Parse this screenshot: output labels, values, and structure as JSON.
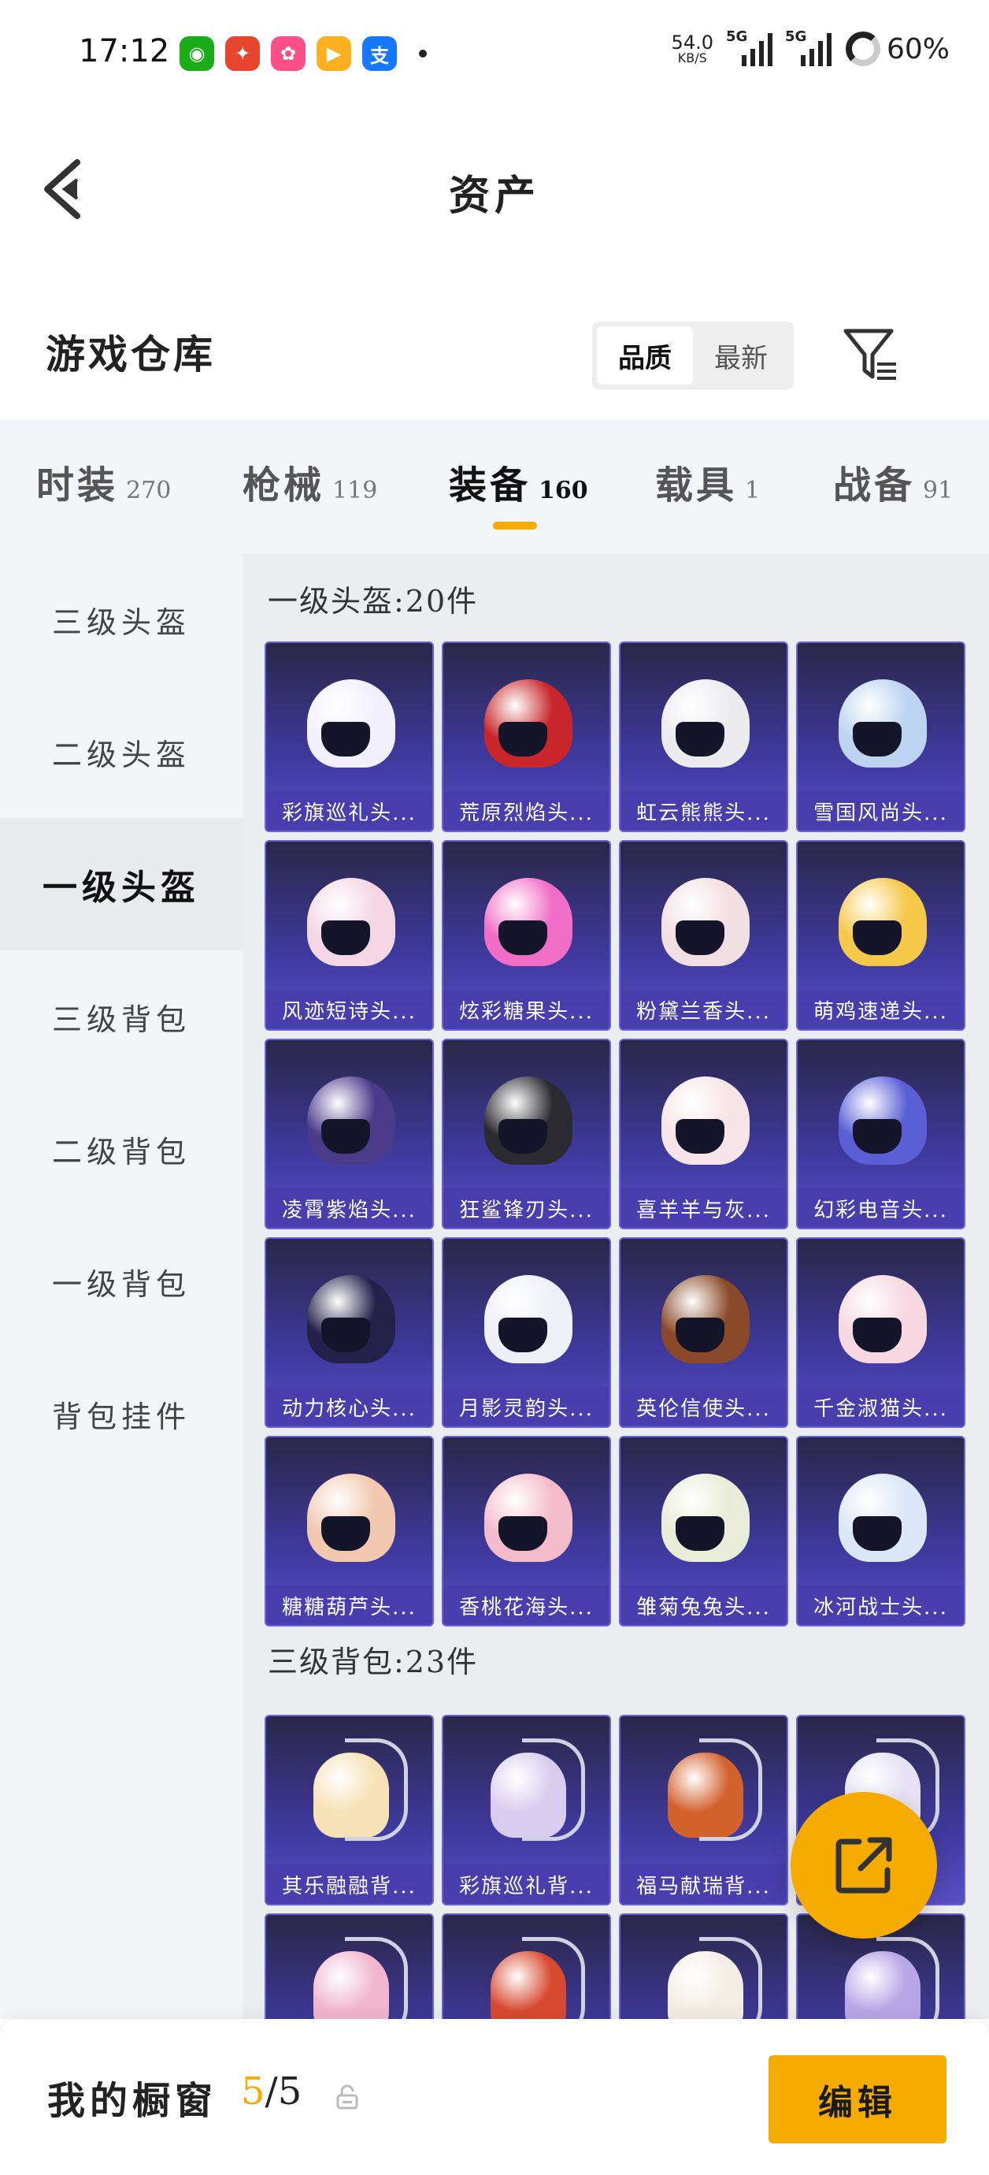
{
  "status_bar": {
    "time": "17:12",
    "apps": [
      {
        "icon": "wechat-icon",
        "glyph": "◉",
        "color": "#1aad19"
      },
      {
        "icon": "red-envelope-app-icon",
        "glyph": "✦",
        "color": "#e8452e"
      },
      {
        "icon": "pink-app-icon",
        "glyph": "✿",
        "color": "#ff4f88"
      },
      {
        "icon": "video-app-icon",
        "glyph": "▶",
        "color": "#ffb020"
      },
      {
        "icon": "alipay-icon",
        "glyph": "支",
        "color": "#1677ff"
      }
    ],
    "net_speed": "54.0",
    "net_unit": "KB/S",
    "sim1": "5G",
    "sim2": "5G",
    "battery": "60%"
  },
  "header": {
    "title": "资产",
    "back_icon": "back-arrow-icon"
  },
  "warehouse": {
    "title": "游戏仓库",
    "sort": [
      "品质",
      "最新"
    ],
    "active_sort": 0,
    "filter_icon": "filter-icon"
  },
  "tabs": [
    {
      "label": "时装",
      "count": "270"
    },
    {
      "label": "枪械",
      "count": "119"
    },
    {
      "label": "装备",
      "count": "160"
    },
    {
      "label": "载具",
      "count": "1"
    },
    {
      "label": "战备",
      "count": "91"
    }
  ],
  "active_tab": 2,
  "sidebar": [
    {
      "label": "三级头盔"
    },
    {
      "label": "二级头盔"
    },
    {
      "label": "一级头盔"
    },
    {
      "label": "三级背包"
    },
    {
      "label": "二级背包"
    },
    {
      "label": "一级背包"
    },
    {
      "label": "背包挂件"
    }
  ],
  "active_side": 2,
  "sections": [
    {
      "title": "一级头盔:20件",
      "items": [
        {
          "name": "彩旗巡礼头...",
          "color": "#f2f0ff"
        },
        {
          "name": "荒原烈焰头...",
          "color": "#c8262a"
        },
        {
          "name": "虹云熊熊头...",
          "color": "#ecebf0"
        },
        {
          "name": "雪国风尚头...",
          "color": "#bcd4f2"
        },
        {
          "name": "风迹短诗头...",
          "color": "#f4d6e4"
        },
        {
          "name": "炫彩糖果头...",
          "color": "#f06ec6"
        },
        {
          "name": "粉黛兰香头...",
          "color": "#f2dfe4"
        },
        {
          "name": "萌鸡速递头...",
          "color": "#f5c84a"
        },
        {
          "name": "凌霄紫焰头...",
          "color": "#4a3a8a"
        },
        {
          "name": "狂鲨锋刃头...",
          "color": "#2a2a30"
        },
        {
          "name": "喜羊羊与灰...",
          "color": "#f7e4e8"
        },
        {
          "name": "幻彩电音头...",
          "color": "#5b5fd6"
        },
        {
          "name": "动力核心头...",
          "color": "#23204a"
        },
        {
          "name": "月影灵韵头...",
          "color": "#eef0f8"
        },
        {
          "name": "英伦信使头...",
          "color": "#8a4a2a"
        },
        {
          "name": "千金淑猫头...",
          "color": "#f6d7e2"
        },
        {
          "name": "糖糖葫芦头...",
          "color": "#f2c8b0"
        },
        {
          "name": "香桃花海头...",
          "color": "#f4bccb"
        },
        {
          "name": "雏菊兔兔头...",
          "color": "#e8ecd8"
        },
        {
          "name": "冰河战士头...",
          "color": "#dbe6f6"
        }
      ]
    },
    {
      "title": "三级背包:23件",
      "items": [
        {
          "name": "其乐融融背...",
          "color": "#f6e2b6"
        },
        {
          "name": "彩旗巡礼背...",
          "color": "#d9cdef"
        },
        {
          "name": "福马献瑞背...",
          "color": "#d3612c"
        },
        {
          "name": "",
          "color": "#e6e2f4"
        },
        {
          "name": "",
          "color": "#f2b6cf"
        },
        {
          "name": "",
          "color": "#d84a30"
        },
        {
          "name": "",
          "color": "#f4ede4"
        },
        {
          "name": "",
          "color": "#b8a6e6"
        }
      ]
    }
  ],
  "fab_icon": "share-icon",
  "bottom_bar": {
    "label": "我的橱窗",
    "count_current": "5",
    "count_sep_total": "/5",
    "lock_icon": "lock-icon",
    "edit_label": "编辑"
  },
  "colors": {
    "accent": "#f5ab00",
    "card_bg": "#3f3aa0",
    "sidebar_bg": "#f3f5f8"
  }
}
